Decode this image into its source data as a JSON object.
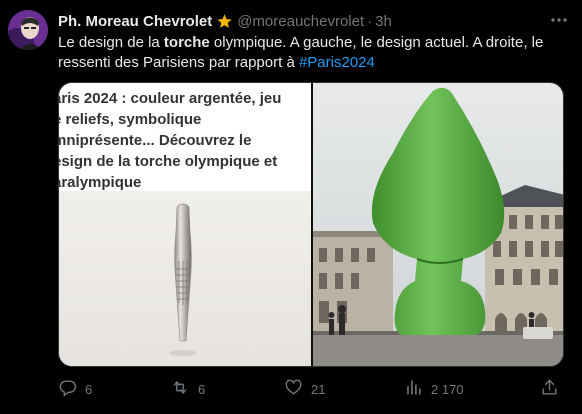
{
  "author": {
    "name": "Ph. Moreau Chevrolet",
    "handle": "@moreauchevrolet",
    "separator": "·",
    "time": "3h"
  },
  "tweet": {
    "part1": "Le design de la ",
    "bold": "torche",
    "part2": " olympique. A gauche, le design actuel. A droite, le ressenti des Parisiens par rapport à ",
    "hashtag": "#Paris2024"
  },
  "media": {
    "left_caption_lines": [
      "aris 2024 : couleur argentée, jeu",
      "e reliefs, symbolique",
      "mniprésente... Découvrez le",
      "esign de la torche olympique et",
      "aralympique"
    ]
  },
  "actions": {
    "replies": "6",
    "reposts": "6",
    "likes": "21",
    "views": "2 170"
  },
  "icons": {
    "verified": "star-badge-icon",
    "more": "more-dots-icon",
    "reply": "reply-icon",
    "repost": "repost-icon",
    "like": "heart-icon",
    "views": "views-icon",
    "share": "share-icon"
  },
  "colors": {
    "background": "#000000",
    "text": "#e7e9ea",
    "muted": "#71767b",
    "link": "#1d9bf0",
    "badge": "#f4b400"
  }
}
